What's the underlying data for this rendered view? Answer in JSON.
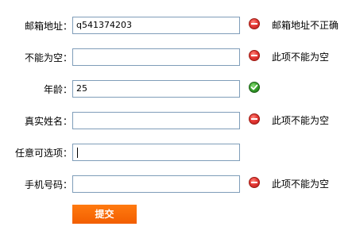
{
  "form": {
    "fields": [
      {
        "label": "邮箱地址：",
        "value": "q541374203",
        "status": "error",
        "status_icon": "error-icon",
        "message": "邮箱地址不正确"
      },
      {
        "label": "不能为空：",
        "value": "",
        "status": "error",
        "status_icon": "error-icon",
        "message": "此项不能为空"
      },
      {
        "label": "年龄：",
        "value": "25",
        "status": "ok",
        "status_icon": "check-icon",
        "message": ""
      },
      {
        "label": "真实姓名：",
        "value": "",
        "status": "error",
        "status_icon": "error-icon",
        "message": "此项不能为空"
      },
      {
        "label": "任意可选项：",
        "value": "",
        "status": "focused",
        "message": ""
      },
      {
        "label": "手机号码：",
        "value": "",
        "status": "error",
        "status_icon": "error-icon",
        "message": "此项不能为空"
      }
    ],
    "submit_label": "提交"
  },
  "colors": {
    "error": "#e53935",
    "ok": "#35a02a",
    "submit": "#ff6a00",
    "field_border": "#7f9db9"
  }
}
